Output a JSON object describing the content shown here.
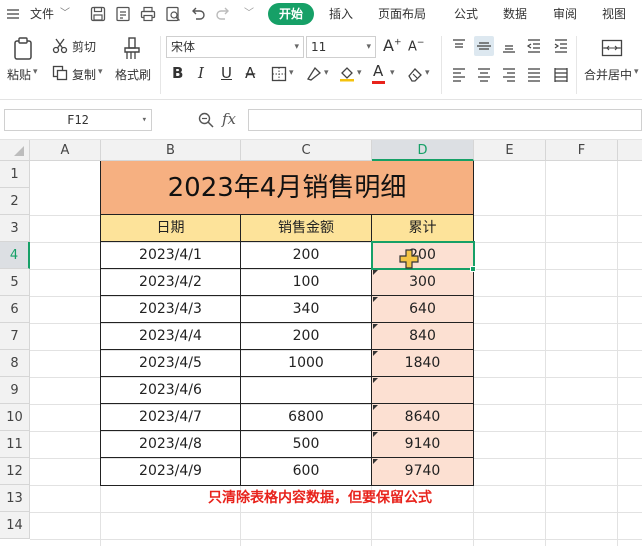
{
  "menubar": {
    "file_label": "文件",
    "tabs": [
      "开始",
      "插入",
      "页面布局",
      "公式",
      "数据",
      "审阅",
      "视图"
    ]
  },
  "ribbon": {
    "paste": "粘贴",
    "cut": "剪切",
    "copy": "复制",
    "format_painter": "格式刷",
    "font_name": "宋体",
    "font_size": "11",
    "merge_center": "合并居中"
  },
  "formula_bar": {
    "name_box": "F12",
    "fx": "fx",
    "formula": ""
  },
  "sheet": {
    "columns": [
      "A",
      "B",
      "C",
      "D",
      "E",
      "F"
    ],
    "rows": [
      "1",
      "2",
      "3",
      "4",
      "5",
      "6",
      "7",
      "8",
      "9",
      "10",
      "11",
      "12",
      "13",
      "14"
    ],
    "title": "2023年4月销售明细",
    "headers": [
      "日期",
      "销售金额",
      "累计"
    ],
    "data": [
      [
        "2023/4/1",
        "200",
        "200"
      ],
      [
        "2023/4/2",
        "100",
        "300"
      ],
      [
        "2023/4/3",
        "340",
        "640"
      ],
      [
        "2023/4/4",
        "200",
        "840"
      ],
      [
        "2023/4/5",
        "1000",
        "1840"
      ],
      [
        "2023/4/6",
        "",
        ""
      ],
      [
        "2023/4/7",
        "6800",
        "8640"
      ],
      [
        "2023/4/8",
        "500",
        "9140"
      ],
      [
        "2023/4/9",
        "600",
        "9740"
      ]
    ],
    "note": "只清除表格内容数据，但要保留公式",
    "colors": {
      "title_bg": "#f6b081",
      "header_bg": "#fde39a",
      "cumul_bg": "#fce0d2",
      "note": "#e8231c",
      "accent": "#16a067"
    }
  }
}
